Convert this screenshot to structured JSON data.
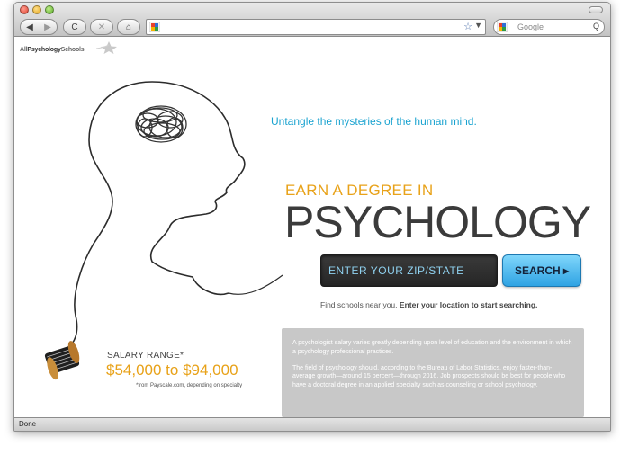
{
  "browser": {
    "url": "",
    "search_placeholder": "Google",
    "status": "Done",
    "back": "◀",
    "forward": "▶",
    "reload": "C",
    "stop": "✕",
    "home": "⌂",
    "bookmark_star": "☆",
    "url_dropdown": "▼",
    "search_glass": "Q"
  },
  "logo": {
    "prefix": "All",
    "middle": "Psychology",
    "suffix": "Schools"
  },
  "hero": {
    "tagline": "Untangle the mysteries of the human mind.",
    "earn_line": "EARN A DEGREE IN",
    "subject": "PSYCHOLOGY"
  },
  "search": {
    "zip_placeholder": "ENTER YOUR ZIP/STATE",
    "button_label": "SEARCH ▸",
    "find_prefix": "Find schools near you.",
    "find_bold": "Enter your location to start searching."
  },
  "salary": {
    "label": "SALARY RANGE*",
    "range": "$54,000 to $94,000",
    "note": "*from Payscale.com, depending on specialty"
  },
  "info": {
    "para1": "A psychologist salary varies greatly depending upon level of education and the environment in which a psychology professional practices.",
    "para2": "The field of psychology should, according to the Bureau of Labor Statistics, enjoy faster-than-average growth—around 15 percent—through 2016. Job prospects should be best for people who have a doctoral degree in an applied specialty such as counseling or school psychology."
  },
  "colors": {
    "accent_blue": "#1aa3d0",
    "accent_gold": "#e8a219",
    "heading_dark": "#3b3b3b"
  }
}
